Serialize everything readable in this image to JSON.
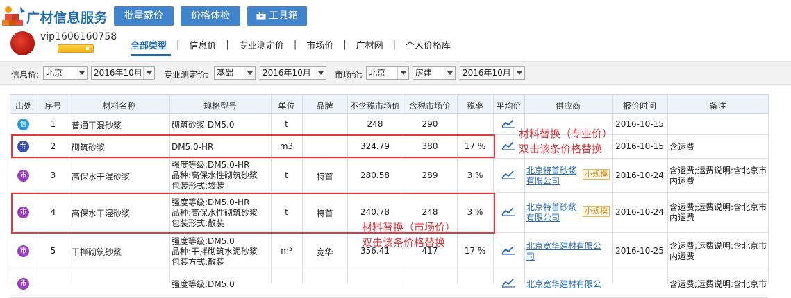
{
  "header": {
    "brand": "广材信息服务",
    "buttons": {
      "batch_price": "批量载价",
      "price_check": "价格体检",
      "toolbox": "工具箱"
    }
  },
  "user": {
    "name": "vip1606160758"
  },
  "nav": {
    "tabs": [
      "全部类型",
      "信息价",
      "专业测定价",
      "市场价",
      "广材网",
      "个人价格库"
    ],
    "active": 0
  },
  "filters": {
    "info_label": "信息价:",
    "info_city": "北京",
    "info_month": "2016年10月",
    "pro_label": "专业测定价:",
    "pro_type": "基础",
    "pro_month": "2016年10月",
    "market_label": "市场价:",
    "market_city": "北京",
    "market_type": "房建",
    "market_month": "2016年10月"
  },
  "table": {
    "headers": [
      "出处",
      "序号",
      "材料名称",
      "规格型号",
      "单位",
      "品牌",
      "不含税市场价",
      "含税市场价",
      "税率",
      "平均价",
      "供应商",
      "报价时间",
      "备注"
    ],
    "rows": [
      {
        "source": "信",
        "source_color": "#2a9be0",
        "no": "1",
        "name": "普通干混砂浆",
        "spec": [
          "砌筑砂浆 DM5.0"
        ],
        "unit": "t",
        "brand": "",
        "price_ex": "248",
        "price_in": "290",
        "tax": "",
        "supplier": [],
        "small_tag": "",
        "date": "2016-10-15",
        "note": []
      },
      {
        "source": "专",
        "source_color": "#3a4fb5",
        "no": "2",
        "name": "砌筑砂浆",
        "spec": [
          "DM5.0-HR"
        ],
        "unit": "m3",
        "brand": "",
        "price_ex": "324.79",
        "price_in": "380",
        "tax": "17 %",
        "supplier": [],
        "small_tag": "",
        "date": "2016-10-15",
        "note": [
          "含运费"
        ]
      },
      {
        "source": "市",
        "source_color": "#9b3fc2",
        "no": "3",
        "name": "高保水干混砂浆",
        "spec": [
          "强度等级:DM5.0-HR",
          "品种:高保水性砌筑砂浆",
          "包装形式:袋装"
        ],
        "unit": "t",
        "brand": "特首",
        "price_ex": "280.58",
        "price_in": "289",
        "tax": "3 %",
        "supplier": [
          "北京特首砂浆",
          "有限公司"
        ],
        "small_tag": "小规模",
        "date": "2016-10-24",
        "note": [
          "含运费;运费说明:含北京市",
          "内运费"
        ]
      },
      {
        "source": "市",
        "source_color": "#9b3fc2",
        "no": "4",
        "name": "高保水干混砂浆",
        "spec": [
          "强度等级:DM5.0-HR",
          "品种:高保水性砌筑砂浆",
          "包装形式:散装"
        ],
        "unit": "t",
        "brand": "特首",
        "price_ex": "240.78",
        "price_in": "248",
        "tax": "3 %",
        "supplier": [
          "北京特首砂浆",
          "有限公司"
        ],
        "small_tag": "小规模",
        "date": "2016-10-24",
        "note": [
          "含运费;运费说明:含北京市",
          "内运费"
        ]
      },
      {
        "source": "市",
        "source_color": "#9b3fc2",
        "no": "5",
        "name": "干拌砌筑砂浆",
        "spec": [
          "强度等级:DM5.0",
          "品种:干拌砌筑水泥砂浆",
          "包装方式:散装"
        ],
        "unit": "m³",
        "brand": "宽华",
        "price_ex": "356.41",
        "price_in": "417",
        "tax": "17 %",
        "supplier": [
          "北京宽华建材有限公",
          "司"
        ],
        "small_tag": "",
        "date": "2016-10-25",
        "note": [
          "含运费;运费说明:含北京市",
          "内运费"
        ]
      },
      {
        "source": "市",
        "source_color": "#9b3fc2",
        "no": "",
        "name": "",
        "spec": [
          "强度等级:DM5.0"
        ],
        "unit": "",
        "brand": "",
        "price_ex": "",
        "price_in": "",
        "tax": "",
        "supplier": [
          "北京宽华建材有限公"
        ],
        "small_tag": "",
        "date": "",
        "note": [
          "含运费;运费说明:含北京市"
        ]
      }
    ]
  },
  "annotations": {
    "a1_line1": "材料替换（专业价）",
    "a1_line2": "双击该条价格替换",
    "a2_line1": "材料替换（市场价）",
    "a2_line2": "双击该条价格替换",
    "color": "#e0393e"
  }
}
